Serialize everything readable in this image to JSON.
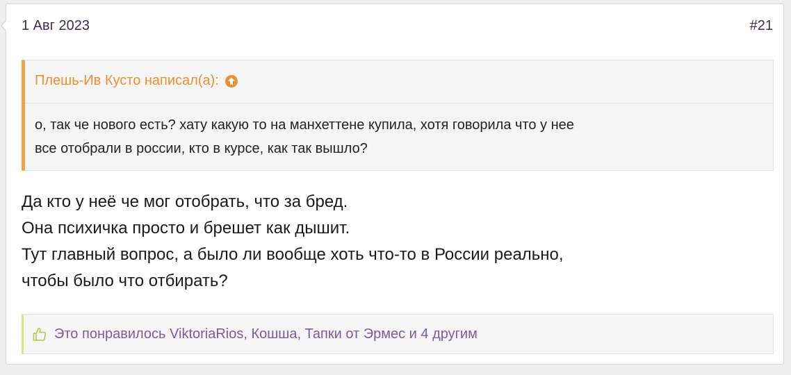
{
  "post": {
    "date": "1 Авг 2023",
    "number": "#21"
  },
  "quote": {
    "author": "Плешь-Ив Кусто написал(а):",
    "lines": [
      "о, так че нового есть? хату какую то на манхеттене купила, хотя говорила что у нее",
      "все отобрали в россии, кто в курсе, как так вышло?"
    ],
    "icon": "circle-up-arrow-icon"
  },
  "message": {
    "lines": [
      "Да кто у неё че мог отобрать, что за бред.",
      "Она психичка просто и брешет как дышит.",
      "Тут главный вопрос, а было ли вообще хоть что-то в России реально,",
      "чтобы было что отбирать?"
    ]
  },
  "likes": {
    "icon": "thumbs-up-icon",
    "text": "Это понравилось ViktoriaRios, Кошша, Тапки от Эрмес и 4 другим"
  },
  "colors": {
    "quote_accent": "#f0a53f",
    "likes_accent": "#d4ea7c",
    "link_purple": "#7a5c9a",
    "date_color": "#3d2a52"
  }
}
